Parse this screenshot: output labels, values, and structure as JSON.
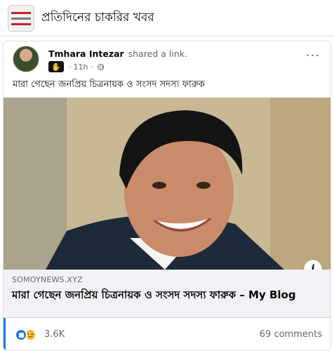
{
  "group": {
    "name": "প্রতিদিনের চাকরির খবর"
  },
  "post": {
    "author": "Tmhara Intezar",
    "action": "shared a link.",
    "time": "11h",
    "separator": "·",
    "text": "মারা গেছেন জনপ্রিয় চিত্রনায়ক ও সংসদ সদস্য ফারুক"
  },
  "link": {
    "domain": "SOMOYNEWS.XYZ",
    "title": "মারা গেছেন জনপ্রিয় চিত্রনায়ক ও সংসদ সদস্য ফারুক – My Blog"
  },
  "stats": {
    "reactions": "3.6K",
    "comments": "69 comments"
  },
  "icons": {
    "more": "more-options-icon",
    "globe": "globe-icon",
    "info": "info-icon",
    "like": "like-reaction-icon",
    "sad": "sad-reaction-icon"
  },
  "colors": {
    "accent": "#1877f2",
    "secondary_text": "#65676b",
    "link_bg": "#f0f2f5"
  }
}
